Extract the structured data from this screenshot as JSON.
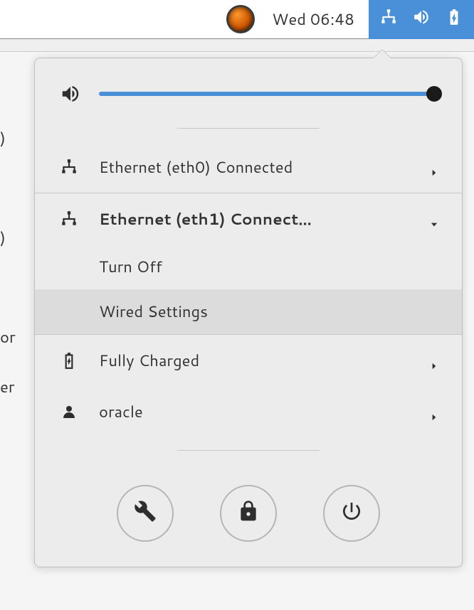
{
  "topbar": {
    "time": "Wed 06:48"
  },
  "popup": {
    "volume": {
      "level": 100
    },
    "items": {
      "eth0": {
        "label": "Ethernet (eth0) Connected"
      },
      "eth1": {
        "label": "Ethernet (eth1) Connect...",
        "submenu": {
          "turn_off": "Turn Off",
          "wired_settings": "Wired Settings"
        }
      },
      "battery": {
        "label": "Fully Charged"
      },
      "user": {
        "label": "oracle"
      }
    }
  },
  "background_text": ")\n\n)\n\nor\ner"
}
